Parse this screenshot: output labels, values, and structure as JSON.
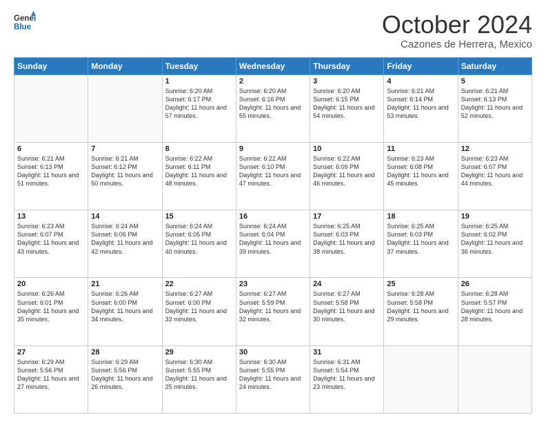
{
  "header": {
    "logo_line1": "General",
    "logo_line2": "Blue",
    "month": "October 2024",
    "location": "Cazones de Herrera, Mexico"
  },
  "days_of_week": [
    "Sunday",
    "Monday",
    "Tuesday",
    "Wednesday",
    "Thursday",
    "Friday",
    "Saturday"
  ],
  "weeks": [
    [
      {
        "day": "",
        "info": ""
      },
      {
        "day": "",
        "info": ""
      },
      {
        "day": "1",
        "info": "Sunrise: 6:20 AM\nSunset: 6:17 PM\nDaylight: 11 hours and 57 minutes."
      },
      {
        "day": "2",
        "info": "Sunrise: 6:20 AM\nSunset: 6:16 PM\nDaylight: 11 hours and 55 minutes."
      },
      {
        "day": "3",
        "info": "Sunrise: 6:20 AM\nSunset: 6:15 PM\nDaylight: 11 hours and 54 minutes."
      },
      {
        "day": "4",
        "info": "Sunrise: 6:21 AM\nSunset: 6:14 PM\nDaylight: 11 hours and 53 minutes."
      },
      {
        "day": "5",
        "info": "Sunrise: 6:21 AM\nSunset: 6:13 PM\nDaylight: 11 hours and 52 minutes."
      }
    ],
    [
      {
        "day": "6",
        "info": "Sunrise: 6:21 AM\nSunset: 6:13 PM\nDaylight: 11 hours and 51 minutes."
      },
      {
        "day": "7",
        "info": "Sunrise: 6:21 AM\nSunset: 6:12 PM\nDaylight: 11 hours and 50 minutes."
      },
      {
        "day": "8",
        "info": "Sunrise: 6:22 AM\nSunset: 6:11 PM\nDaylight: 11 hours and 48 minutes."
      },
      {
        "day": "9",
        "info": "Sunrise: 6:22 AM\nSunset: 6:10 PM\nDaylight: 11 hours and 47 minutes."
      },
      {
        "day": "10",
        "info": "Sunrise: 6:22 AM\nSunset: 6:09 PM\nDaylight: 11 hours and 46 minutes."
      },
      {
        "day": "11",
        "info": "Sunrise: 6:23 AM\nSunset: 6:08 PM\nDaylight: 11 hours and 45 minutes."
      },
      {
        "day": "12",
        "info": "Sunrise: 6:23 AM\nSunset: 6:07 PM\nDaylight: 11 hours and 44 minutes."
      }
    ],
    [
      {
        "day": "13",
        "info": "Sunrise: 6:23 AM\nSunset: 6:07 PM\nDaylight: 11 hours and 43 minutes."
      },
      {
        "day": "14",
        "info": "Sunrise: 6:24 AM\nSunset: 6:06 PM\nDaylight: 11 hours and 42 minutes."
      },
      {
        "day": "15",
        "info": "Sunrise: 6:24 AM\nSunset: 6:05 PM\nDaylight: 11 hours and 40 minutes."
      },
      {
        "day": "16",
        "info": "Sunrise: 6:24 AM\nSunset: 6:04 PM\nDaylight: 11 hours and 39 minutes."
      },
      {
        "day": "17",
        "info": "Sunrise: 6:25 AM\nSunset: 6:03 PM\nDaylight: 11 hours and 38 minutes."
      },
      {
        "day": "18",
        "info": "Sunrise: 6:25 AM\nSunset: 6:03 PM\nDaylight: 11 hours and 37 minutes."
      },
      {
        "day": "19",
        "info": "Sunrise: 6:25 AM\nSunset: 6:02 PM\nDaylight: 11 hours and 36 minutes."
      }
    ],
    [
      {
        "day": "20",
        "info": "Sunrise: 6:26 AM\nSunset: 6:01 PM\nDaylight: 11 hours and 35 minutes."
      },
      {
        "day": "21",
        "info": "Sunrise: 6:26 AM\nSunset: 6:00 PM\nDaylight: 11 hours and 34 minutes."
      },
      {
        "day": "22",
        "info": "Sunrise: 6:27 AM\nSunset: 6:00 PM\nDaylight: 11 hours and 33 minutes."
      },
      {
        "day": "23",
        "info": "Sunrise: 6:27 AM\nSunset: 5:59 PM\nDaylight: 11 hours and 32 minutes."
      },
      {
        "day": "24",
        "info": "Sunrise: 6:27 AM\nSunset: 5:58 PM\nDaylight: 11 hours and 30 minutes."
      },
      {
        "day": "25",
        "info": "Sunrise: 6:28 AM\nSunset: 5:58 PM\nDaylight: 11 hours and 29 minutes."
      },
      {
        "day": "26",
        "info": "Sunrise: 6:28 AM\nSunset: 5:57 PM\nDaylight: 11 hours and 28 minutes."
      }
    ],
    [
      {
        "day": "27",
        "info": "Sunrise: 6:29 AM\nSunset: 5:56 PM\nDaylight: 11 hours and 27 minutes."
      },
      {
        "day": "28",
        "info": "Sunrise: 6:29 AM\nSunset: 5:56 PM\nDaylight: 11 hours and 26 minutes."
      },
      {
        "day": "29",
        "info": "Sunrise: 6:30 AM\nSunset: 5:55 PM\nDaylight: 11 hours and 25 minutes."
      },
      {
        "day": "30",
        "info": "Sunrise: 6:30 AM\nSunset: 5:55 PM\nDaylight: 11 hours and 24 minutes."
      },
      {
        "day": "31",
        "info": "Sunrise: 6:31 AM\nSunset: 5:54 PM\nDaylight: 11 hours and 23 minutes."
      },
      {
        "day": "",
        "info": ""
      },
      {
        "day": "",
        "info": ""
      }
    ]
  ]
}
